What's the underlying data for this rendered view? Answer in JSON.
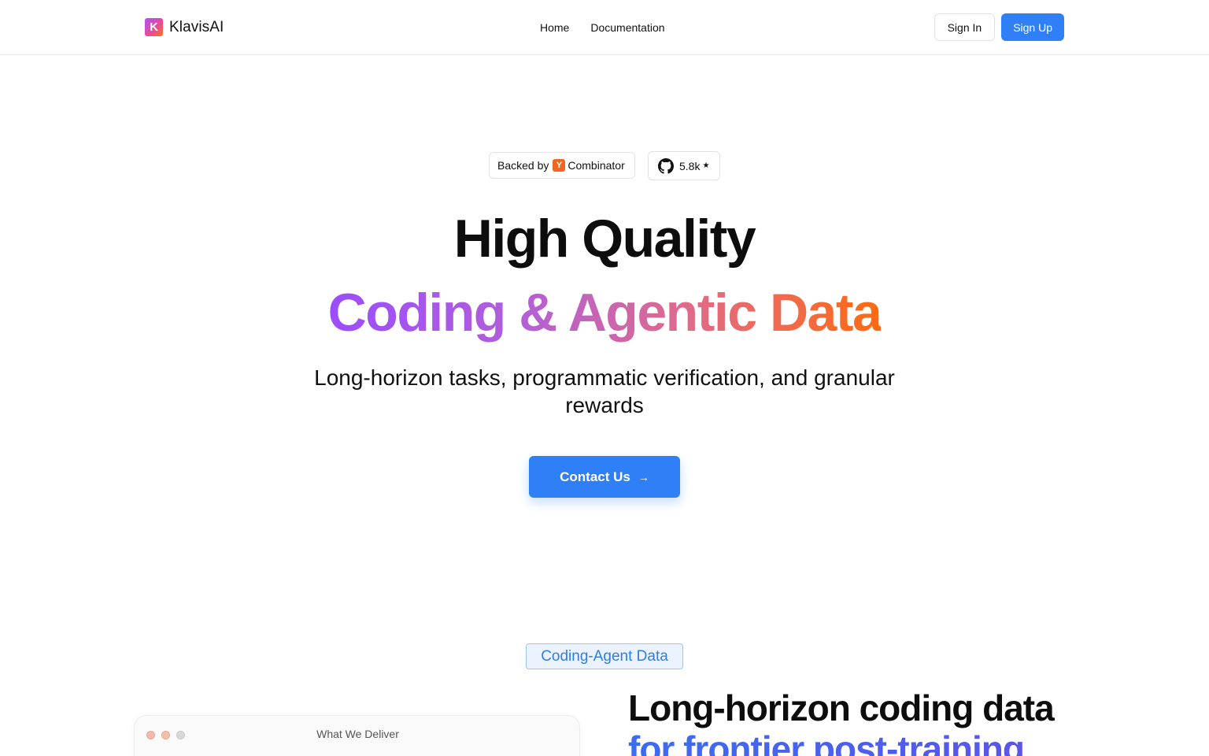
{
  "header": {
    "brand_logo_letter": "K",
    "brand_name": "KlavisAI",
    "nav": [
      {
        "label": "Home"
      },
      {
        "label": "Documentation"
      }
    ],
    "sign_in_label": "Sign In",
    "sign_up_label": "Sign Up"
  },
  "badges": {
    "backed_by": "Backed by",
    "yc_mark": "Y",
    "combinator": "Combinator",
    "github_stars": "5.8k",
    "star_glyph": "★",
    "github_icon": "github-icon"
  },
  "hero": {
    "title_line1": "High Quality",
    "title_line2": "Coding & Agentic Data",
    "subtitle": "Long-horizon tasks, programmatic verification, and granular rewards",
    "cta_label": "Contact Us",
    "cta_arrow": "→"
  },
  "section": {
    "tag": "Coding-Agent Data",
    "window_title": "What We Deliver",
    "heading_line1": "Long-horizon coding data",
    "heading_line2": "for frontier post-training"
  },
  "colors": {
    "primary": "#2f80f7",
    "gradient_start": "#9b4dff",
    "gradient_end": "#ff6a10",
    "yc_orange": "#f26522"
  }
}
